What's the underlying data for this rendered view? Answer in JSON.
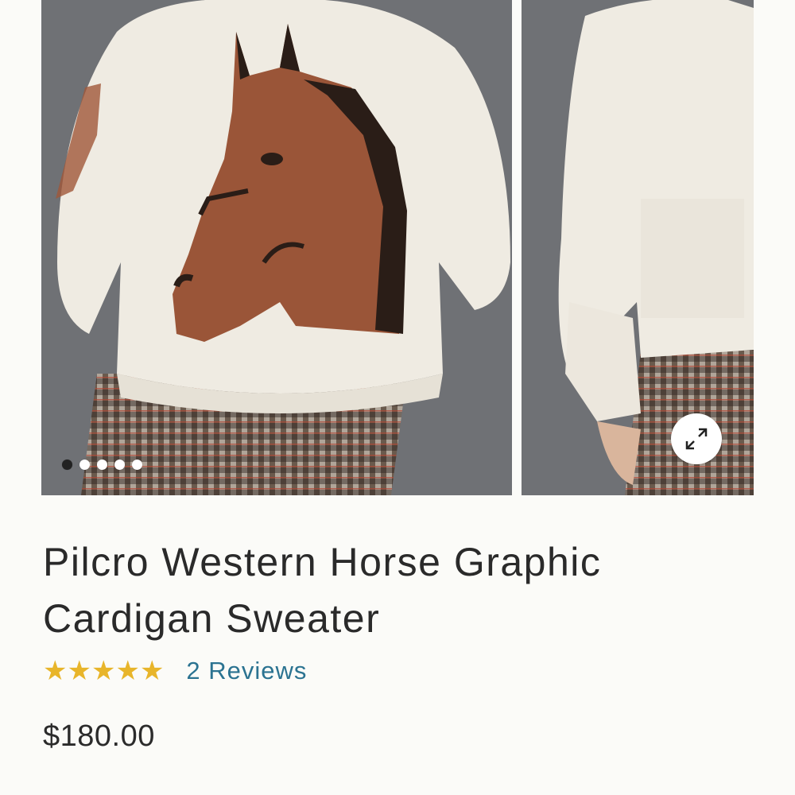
{
  "product": {
    "title": "Pilcro Western Horse Graphic Cardigan Sweater",
    "rating": {
      "stars": 5,
      "max": 5,
      "reviews_label": "2 Reviews"
    },
    "price": "$180.00"
  },
  "gallery": {
    "slide_count": 5,
    "active_slide": 1,
    "expand_icon": "expand-icon"
  },
  "colors": {
    "star": "#e8b52a",
    "link": "#2b7391",
    "text": "#2b2b2b",
    "photo_bg": "#707276"
  }
}
